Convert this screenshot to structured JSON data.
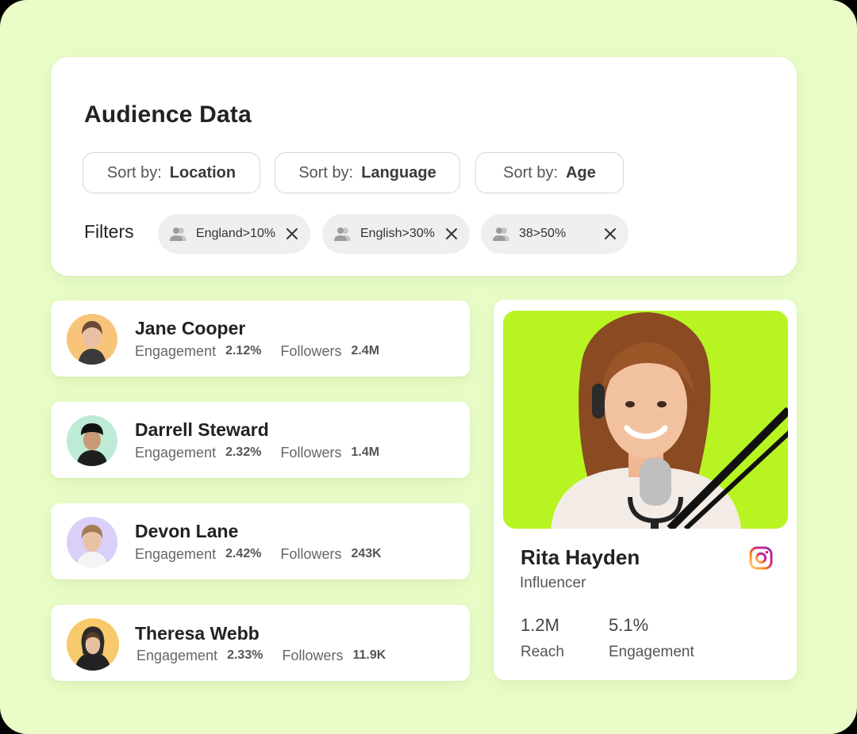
{
  "audience": {
    "title": "Audience Data",
    "sort_prefix": "Sort by:",
    "sort": [
      {
        "value": "Location"
      },
      {
        "value": "Language"
      },
      {
        "value": "Age"
      }
    ],
    "filters_label": "Filters",
    "filters": [
      {
        "label": "England>10%",
        "icon": "people-icon"
      },
      {
        "label": "English>30%",
        "icon": "people-icon"
      },
      {
        "label": "38>50%",
        "icon": "people-icon"
      }
    ]
  },
  "influencers": [
    {
      "name": "Jane Cooper",
      "engagement_label": "Engagement",
      "engagement": "2.12%",
      "followers_label": "Followers",
      "followers": "2.4M",
      "avatar_bg": "#f8c47a"
    },
    {
      "name": "Darrell Steward",
      "engagement_label": "Engagement",
      "engagement": "2.32%",
      "followers_label": "Followers",
      "followers": "1.4M",
      "avatar_bg": "#bdebd6"
    },
    {
      "name": "Devon Lane",
      "engagement_label": "Engagement",
      "engagement": "2.42%",
      "followers_label": "Followers",
      "followers": "243K",
      "avatar_bg": "#d9cff8"
    },
    {
      "name": "Theresa Webb",
      "engagement_label": "Engagement",
      "engagement": "2.33%",
      "followers_label": "Followers",
      "followers": "11.9K",
      "avatar_bg": "#f8c96a"
    }
  ],
  "profile": {
    "name": "Rita Hayden",
    "role": "Influencer",
    "social_icon": "instagram-icon",
    "photo_bg": "#b8f422",
    "reach_value": "1.2M",
    "reach_label": "Reach",
    "engagement_value": "5.1%",
    "engagement_label": "Engagement"
  },
  "colors": {
    "page_bg": "#eafdc8",
    "accent_green": "#b8f422"
  }
}
